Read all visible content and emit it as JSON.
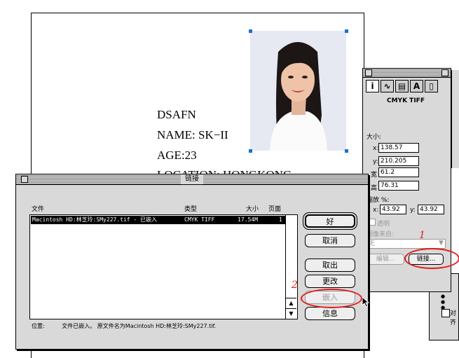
{
  "document": {
    "lines": [
      "DSAFN",
      "NAME: SK−II",
      "AGE:23",
      "LOCATION: HONGKONG"
    ]
  },
  "info_palette": {
    "tabs": [
      "i-icon",
      "link-icon",
      "frame-icon",
      "A",
      "page-icon"
    ],
    "file_type": "CMYK TIFF",
    "size_label": "大小:",
    "x_label": "x:",
    "x_value": "138.57",
    "y_label": "y:",
    "y_value": "210.205",
    "width_label": "宽",
    "width_value": "61.2",
    "height_label": "高",
    "height_value": "76.31",
    "scale_label": "缩放 %:",
    "scale_x_label": "x:",
    "scale_x_value": "43.92",
    "scale_y_label": "y:",
    "scale_y_value": "43.92",
    "transparent_label": "透明",
    "image_source_label": "图像来自:",
    "image_source_value": "无",
    "edit_button": "编辑...",
    "link_button": "链接..."
  },
  "links_dialog": {
    "title": "链接",
    "columns": {
      "file": "文件",
      "type": "类型",
      "size": "大小",
      "page": "页面"
    },
    "rows": [
      {
        "file": "Macintosh HD:林芝玲:SMy227.tif - 已嵌入",
        "type": "CMYK TIFF",
        "size": "17.54M",
        "page": "1"
      }
    ],
    "buttons": {
      "ok": "好",
      "cancel": "取消",
      "get": "取出",
      "change": "更改",
      "embed": "嵌入",
      "info": "信息"
    },
    "status_label": "位置:",
    "status_text": "文件已嵌入。 原文件名为Macintosh HD:林芝玲:SMy227.tif."
  },
  "annotations": {
    "one": "1",
    "two": "2"
  },
  "colors": {
    "annotation": "#e21b1b",
    "handle": "#1e6fd1"
  }
}
